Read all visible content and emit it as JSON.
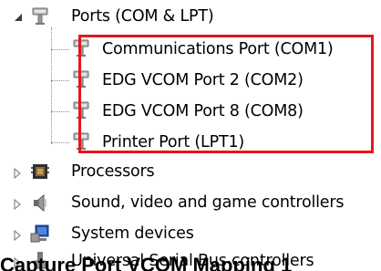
{
  "tree": {
    "ports_group": {
      "label": "Ports (COM & LPT)",
      "icon": "port-connector-icon",
      "expander": "expanded",
      "children": [
        {
          "label": "Communications Port (COM1)",
          "icon": "port-connector-icon"
        },
        {
          "label": "EDG VCOM Port 2 (COM2)",
          "icon": "port-connector-icon"
        },
        {
          "label": "EDG VCOM Port 8 (COM8)",
          "icon": "port-connector-icon"
        },
        {
          "label": "Printer Port (LPT1)",
          "icon": "port-connector-icon"
        }
      ]
    },
    "categories": [
      {
        "label": "Processors",
        "icon": "processor-chip-icon",
        "expander": "collapsed"
      },
      {
        "label": "Sound, video and game controllers",
        "icon": "speaker-icon",
        "expander": "collapsed"
      },
      {
        "label": "System devices",
        "icon": "system-devices-icon",
        "expander": "collapsed"
      },
      {
        "label": "Universal Serial Bus controllers",
        "icon": "usb-icon",
        "expander": "collapsed"
      }
    ]
  },
  "caption": "Capture Port VCOM Mapping 1",
  "colors": {
    "highlight": "#e8141d",
    "tree_line": "#8c8c8c",
    "text": "#000000"
  }
}
